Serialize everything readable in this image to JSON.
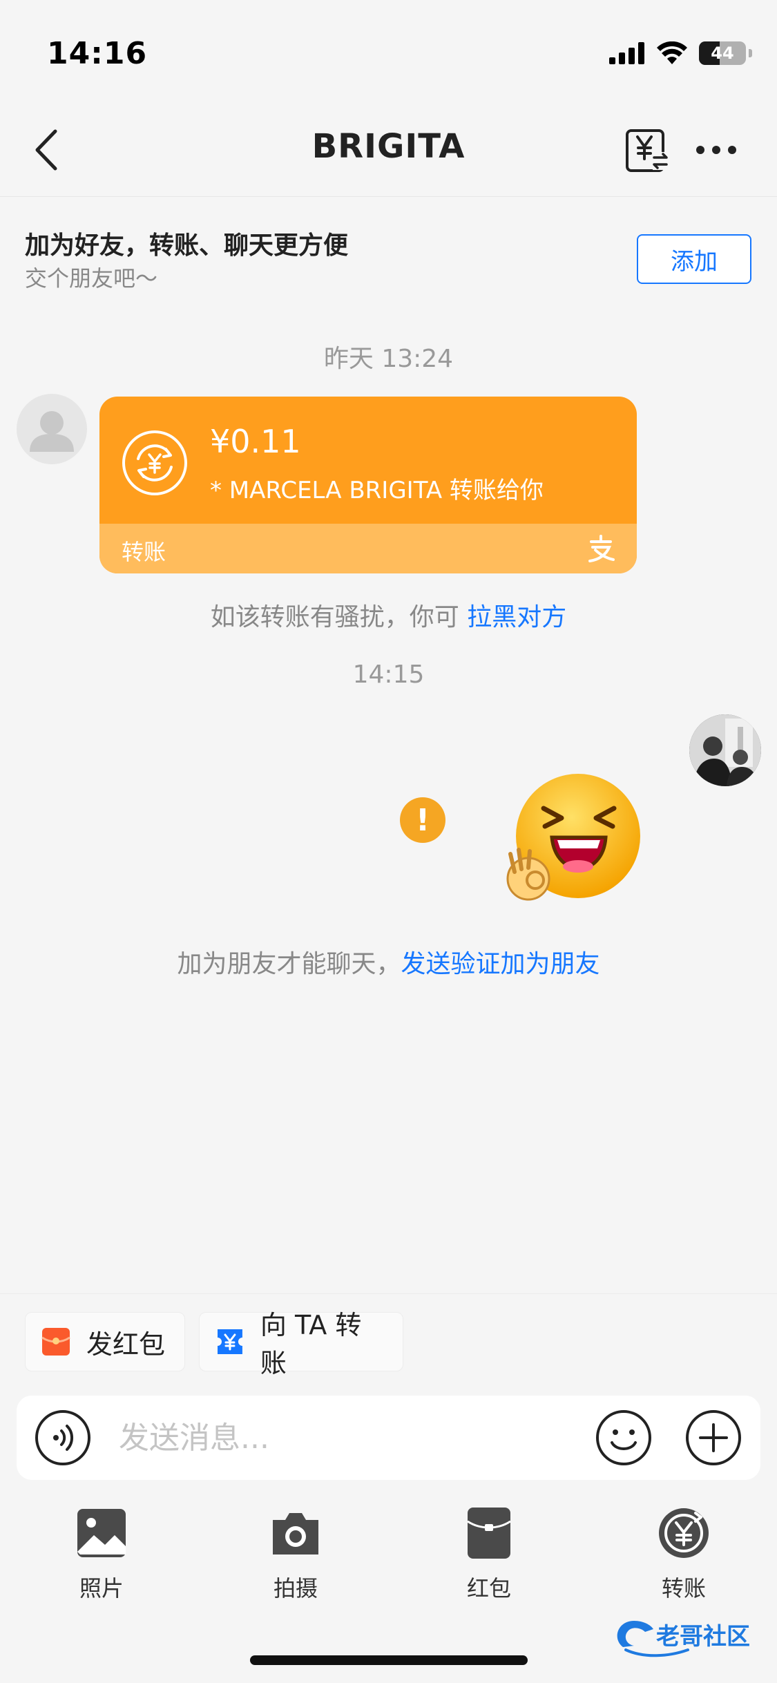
{
  "status_bar": {
    "time": "14:16",
    "battery": "44",
    "battery_fraction": 0.44
  },
  "nav": {
    "title": "BRIGITA",
    "icons": [
      "back-chevron-icon",
      "transfer-icon",
      "more-icon"
    ]
  },
  "friend_banner": {
    "title": "加为好友，转账、聊天更方便",
    "subtitle": "交个朋友吧～",
    "add_label": "添加"
  },
  "messages": {
    "time_1": "昨天 13:24",
    "transfer_card": {
      "amount": "¥0.11",
      "description": "* MARCELA BRIGITA 转账给你",
      "footer_label": "转账",
      "footer_logo": "alipay-logo-icon"
    },
    "harass_notice": {
      "text": "如该转账有骚扰，你可 ",
      "link": "拉黑对方"
    },
    "time_2": "14:15",
    "friend_notice": {
      "text": "加为朋友才能聊天，",
      "link": "发送验证加为朋友"
    }
  },
  "quick_actions": {
    "red_packet": "发红包",
    "transfer_to_ta": "向 TA 转账"
  },
  "input": {
    "placeholder": "发送消息..."
  },
  "panel": {
    "items": [
      {
        "label": "照片",
        "icon": "photo-icon"
      },
      {
        "label": "拍摄",
        "icon": "camera-icon"
      },
      {
        "label": "红包",
        "icon": "red-packet-icon"
      },
      {
        "label": "转账",
        "icon": "transfer-icon"
      }
    ]
  },
  "watermark": "老哥社区",
  "colors": {
    "accent_blue": "#1677ff",
    "card_orange": "#ff9e1d",
    "card_footer": "#ffbc5c",
    "warn": "#f5a623"
  }
}
